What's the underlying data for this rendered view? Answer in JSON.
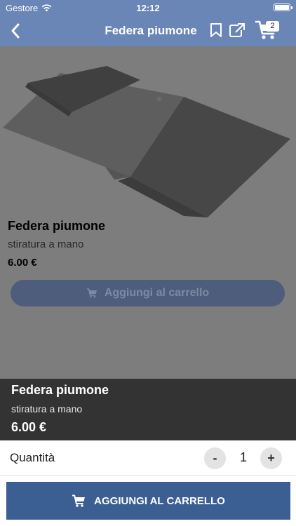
{
  "status_bar": {
    "carrier": "Gestore",
    "time": "12:12",
    "wifi_icon": "wifi-icon",
    "battery_icon": "battery-icon"
  },
  "nav": {
    "title": "Federa piumone",
    "back_icon": "chevron-left-icon",
    "bookmark_icon": "bookmark-icon",
    "share_icon": "share-external-icon",
    "cart_icon": "cart-icon",
    "cart_count": "2"
  },
  "product": {
    "name": "Federa piumone",
    "description": "stiratura a mano",
    "price": "6.00 €",
    "add_to_cart_label": "Aggiungi al carrello"
  },
  "summary": {
    "name": "Federa piumone",
    "description": "stiratura a mano",
    "price": "6.00 €"
  },
  "quantity": {
    "label": "Quantità",
    "value": "1",
    "decrement": "-",
    "increment": "+"
  },
  "action": {
    "label": "AGGIUNGI AL CARRELLO"
  },
  "colors": {
    "nav": "#6a86b6",
    "overlay": "#7d7d7d",
    "info_strip": "#333333",
    "primary": "#3c5f93"
  }
}
